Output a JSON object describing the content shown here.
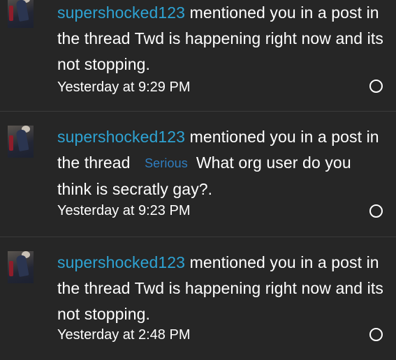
{
  "alerts": [
    {
      "username": "supershocked123",
      "action": " mentioned you in a post in the thread ",
      "prefix": "",
      "thread_title": "Twd is happening right now and its not stopping.",
      "time": "Yesterday at 9:29 PM"
    },
    {
      "username": "supershocked123",
      "action": " mentioned you in a post in the thread ",
      "prefix": "Serious",
      "thread_title": "What org user do you think is secratly gay?.",
      "time": "Yesterday at 9:23 PM"
    },
    {
      "username": "supershocked123",
      "action": " mentioned you in a post in the thread ",
      "prefix": "",
      "thread_title": "Twd is happening right now and its not stopping.",
      "time": "Yesterday at 2:48 PM"
    }
  ],
  "icons": {
    "read_toggle": "circle-outline-icon",
    "avatar": "user-avatar"
  },
  "colors": {
    "background": "#262626",
    "username": "#2ea3d3",
    "prefix": "#2f7ec0",
    "text": "#ffffff",
    "divider": "#3a3a3a"
  }
}
